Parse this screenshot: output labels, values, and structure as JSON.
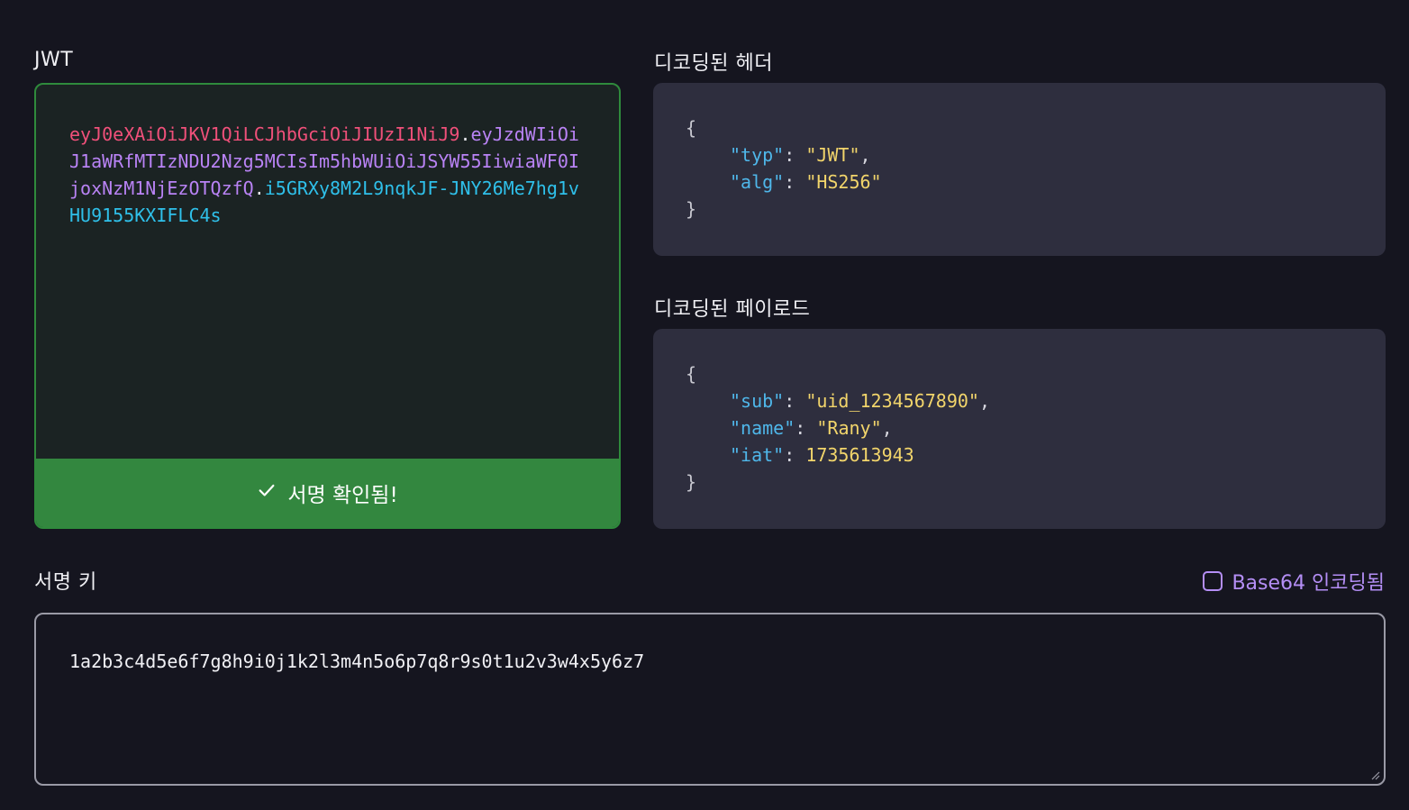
{
  "jwt": {
    "label": "JWT",
    "token_header": "eyJ0eXAiOiJKV1QiLCJhbGciOiJIUzI1NiJ9",
    "token_payload": "eyJzdWIiOiJ1aWRfMTIzNDU2Nzg5MCIsIm5hbWUiOiJSYW55IiwiaWF0IjoxNzM1NjEzOTQzfQ",
    "token_signature": "i5GRXy8M2L9nqkJF-JNY26Me7hg1vHU9155KXIFLC4s",
    "dot": ".",
    "verify_status": "서명 확인됨!"
  },
  "header": {
    "label": "디코딩된 헤더",
    "open_brace": "{",
    "close_brace": "}",
    "fields": [
      {
        "key": "typ",
        "value": "\"JWT\"",
        "sep": ","
      },
      {
        "key": "alg",
        "value": "\"HS256\"",
        "sep": ""
      }
    ]
  },
  "payload": {
    "label": "디코딩된 페이로드",
    "open_brace": "{",
    "close_brace": "}",
    "fields": [
      {
        "key": "sub",
        "value": "\"uid_1234567890\"",
        "sep": ","
      },
      {
        "key": "name",
        "value": "\"Rany\"",
        "sep": ","
      },
      {
        "key": "iat",
        "value": "1735613943",
        "sep": ""
      }
    ]
  },
  "signature_key": {
    "label": "서명 키",
    "value": "1a2b3c4d5e6f7g8h9i0j1k2l3m4n5o6p7q8r9s0t1u2v3w4x5y6z7",
    "base64_label": "Base64 인코딩됨",
    "base64_checked": false
  },
  "colors": {
    "background": "#15151f",
    "success": "#33873f",
    "token_header": "#f0507a",
    "token_payload": "#b983f5",
    "token_signature": "#2fc0ea",
    "json_key": "#4fb7ea",
    "json_value": "#f2d56b",
    "accent": "#b48ef5"
  },
  "icons": {
    "verify": "check-icon",
    "base64": "checkbox-icon",
    "resize": "resize-handle-icon"
  }
}
